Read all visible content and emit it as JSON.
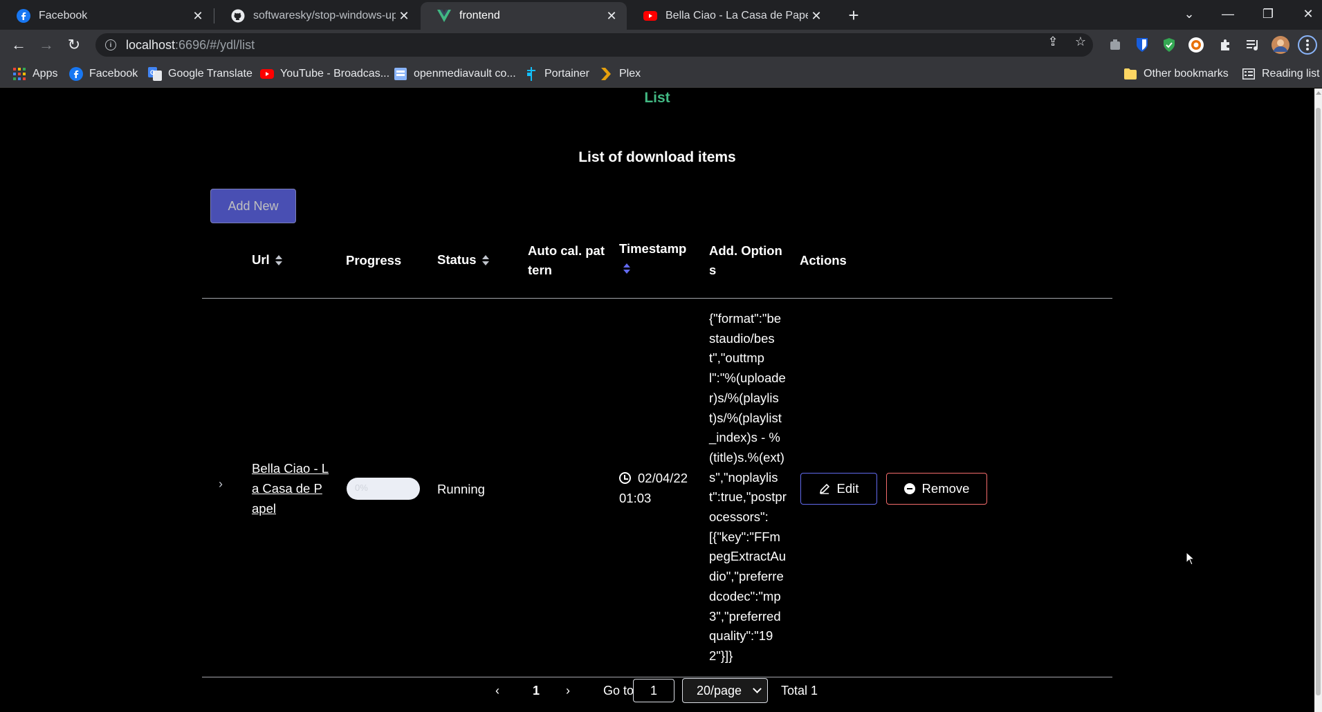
{
  "browser": {
    "tabs": [
      {
        "title": "Facebook",
        "icon": "facebook-icon",
        "active": false
      },
      {
        "title": "softwaresky/stop-windows-upda",
        "icon": "github-icon",
        "active": false
      },
      {
        "title": "frontend",
        "icon": "vue-icon",
        "active": true
      },
      {
        "title": "Bella Ciao - La Casa de Papel - Yo",
        "icon": "youtube-icon",
        "active": false
      }
    ],
    "new_tab": "+",
    "url_host": "localhost",
    "url_path": ":6696/#/ydl/list",
    "bookmarks": [
      {
        "label": "Apps",
        "icon": "apps-grid-icon"
      },
      {
        "label": "Facebook",
        "icon": "facebook-icon"
      },
      {
        "label": "Google Translate",
        "icon": "google-translate-icon"
      },
      {
        "label": "YouTube - Broadcas...",
        "icon": "youtube-icon"
      },
      {
        "label": "openmediavault co...",
        "icon": "openmediavault-icon"
      },
      {
        "label": "Portainer",
        "icon": "portainer-icon"
      },
      {
        "label": "Plex",
        "icon": "plex-icon"
      }
    ],
    "other_bookmarks": "Other bookmarks",
    "reading_list": "Reading list"
  },
  "nav": {
    "list_link": "List"
  },
  "page": {
    "heading": "List of download items",
    "add_button": "Add New"
  },
  "table": {
    "headers": {
      "url": "Url",
      "progress": "Progress",
      "status": "Status",
      "auto_cal_pattern": "Auto cal. pattern",
      "timestamp": "Timestamp",
      "add_options": "Add. Options",
      "actions": "Actions"
    },
    "rows": [
      {
        "url_title": "Bella Ciao - La Casa de Papel",
        "progress_percent": 0,
        "progress_label": "0%",
        "status": "Running",
        "auto_cal_pattern": "",
        "timestamp": "02/04/22 01:03",
        "add_options": "{\"format\":\"bestaudio/best\",\"outtmpl\":\"%(uploader)s/%(playlist)s/%(playlist_index)s - %(title)s.%(ext)s\",\"noplaylist\":true,\"postprocessors\":[{\"key\":\"FFmpegExtractAudio\",\"preferredcodec\":\"mp3\",\"preferredquality\":\"192\"}]}",
        "edit_label": "Edit",
        "remove_label": "Remove"
      }
    ]
  },
  "pagination": {
    "current_page": "1",
    "goto_label": "Go to",
    "goto_value": "1",
    "page_size": "20/page",
    "total": "Total 1"
  },
  "colors": {
    "accent": "#626aef",
    "danger": "#f56c6c",
    "nav_active": "#42b983",
    "background": "#000000"
  }
}
